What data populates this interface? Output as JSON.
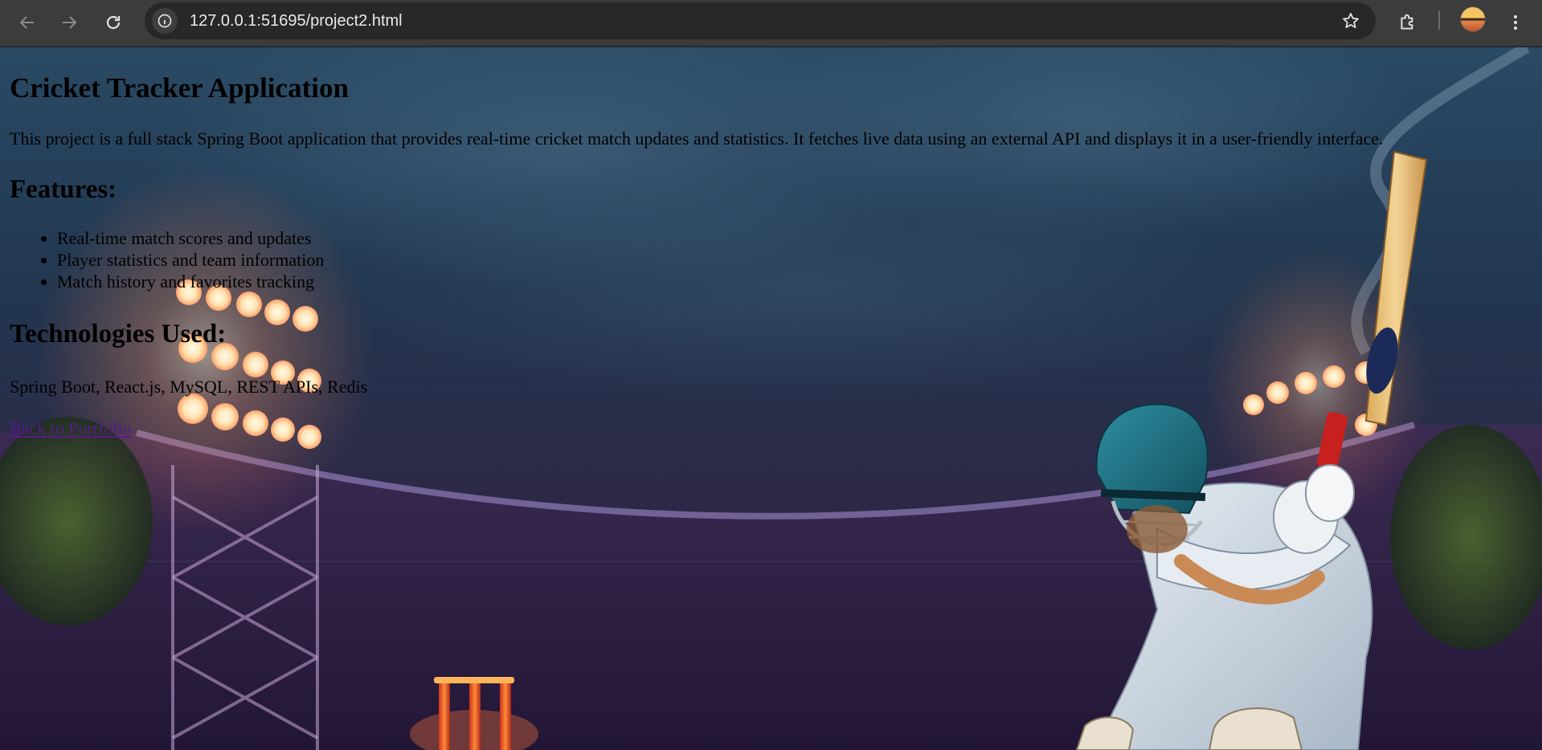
{
  "browser": {
    "url": "127.0.0.1:51695/project2.html",
    "icons": {
      "back": "arrow-left-icon",
      "forward": "arrow-right-icon",
      "reload": "reload-icon",
      "site_info": "info-icon",
      "bookmark": "star-icon",
      "extensions": "puzzle-icon",
      "profile": "avatar",
      "menu": "kebab-menu-icon"
    }
  },
  "page": {
    "title": "Cricket Tracker Application",
    "description": "This project is a full stack Spring Boot application that provides real-time cricket match updates and statistics. It fetches live data using an external API and displays it in a user-friendly interface.",
    "features_heading": "Features:",
    "features": [
      "Real-time match scores and updates",
      "Player statistics and team information",
      "Match history and favorites tracking"
    ],
    "technologies_heading": "Technologies Used:",
    "technologies": "Spring Boot, React.js, MySQL, REST APIs, Redis",
    "back_link": "Back to Portfolio",
    "background": "cricket-batsman-stadium-night-illustration"
  }
}
